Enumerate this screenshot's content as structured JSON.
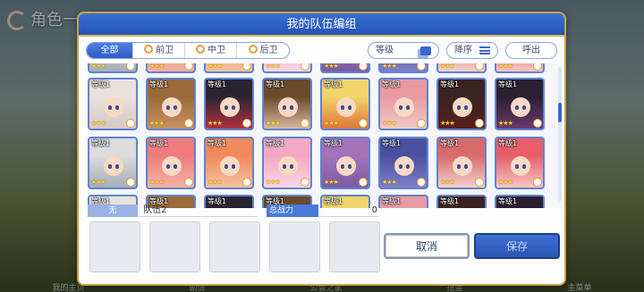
{
  "background": {
    "title": "角色一览",
    "bottom_nav": [
      "我的主页",
      "剧情",
      "公会之家",
      "扭蛋",
      "主菜单"
    ]
  },
  "dialog": {
    "title": "我的队伍编组"
  },
  "filters": {
    "tabs": [
      {
        "label": "全部",
        "active": true
      },
      {
        "label": "前卫",
        "active": false
      },
      {
        "label": "中卫",
        "active": false
      },
      {
        "label": "后卫",
        "active": false
      }
    ],
    "level_label": "等级",
    "sort_label": "降序",
    "call_label": "呼出"
  },
  "roster": {
    "level_text": "等级1",
    "row1": [
      {
        "stars": "★★★",
        "hair": "#e9e2dc",
        "bg": "#d8c7c2"
      },
      {
        "stars": "★★★",
        "hair": "#9a6a3a",
        "bg": "#c99160"
      },
      {
        "stars": "★★★",
        "hair": "#2b2430",
        "bg": "#b0303f"
      },
      {
        "stars": "★★★",
        "hair": "#6b4a2c",
        "bg": "#d8b9a2"
      },
      {
        "stars": "★★★",
        "hair": "#f1d46a",
        "bg": "#e0763a"
      },
      {
        "stars": "★★★",
        "hair": "#e79aa2",
        "bg": "#f0c9c3"
      },
      {
        "stars": "★★★",
        "hair": "#3a2320",
        "bg": "#5a1e1a"
      },
      {
        "stars": "★★★",
        "hair": "#2a2030",
        "bg": "#6a3a6c"
      }
    ],
    "row2": [
      {
        "stars": "★★★",
        "hair": "#dcdcdc",
        "bg": "#a5adb8"
      },
      {
        "stars": "★★★",
        "hair": "#ef7b7e",
        "bg": "#f3b3a6"
      },
      {
        "stars": "★★★",
        "hair": "#f08a5a",
        "bg": "#f4c2a3"
      },
      {
        "stars": "★★★",
        "hair": "#f3a8c3",
        "bg": "#f9d6e3"
      },
      {
        "stars": "★★★",
        "hair": "#a273b8",
        "bg": "#7c5aa3"
      },
      {
        "stars": "★★★",
        "hair": "#4b4f9e",
        "bg": "#7f7fc8"
      },
      {
        "stars": "★★★",
        "hair": "#d86a6a",
        "bg": "#f2d2cc"
      },
      {
        "stars": "★★★",
        "hair": "#e65e6a",
        "bg": "#f6c6c3"
      }
    ]
  },
  "team": {
    "unlabel": "无",
    "name": "队伍2",
    "power_label": "总战力",
    "power_value": "0"
  },
  "buttons": {
    "cancel": "取消",
    "save": "保存"
  }
}
